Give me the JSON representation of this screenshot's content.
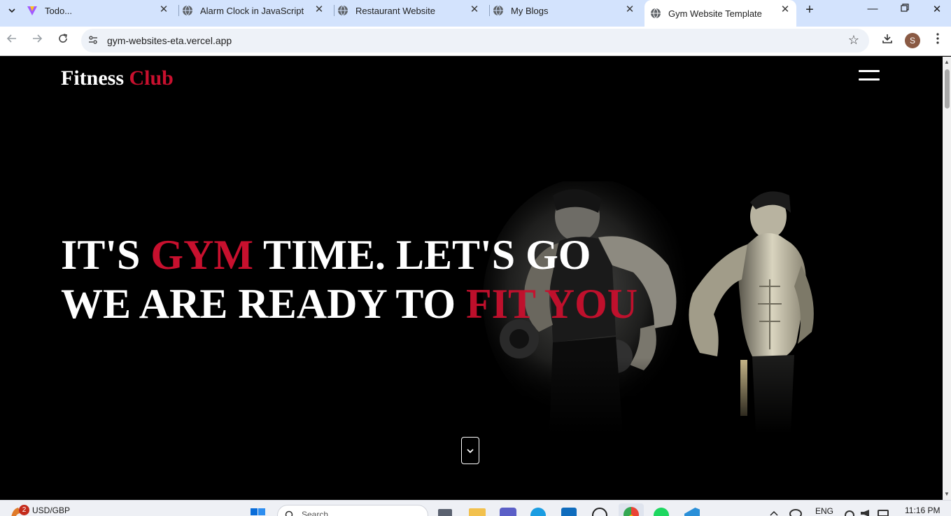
{
  "browser": {
    "tabs": [
      {
        "title": "Todo...",
        "icon": "vite-icon"
      },
      {
        "title": "Alarm Clock in JavaScript",
        "icon": "globe-icon"
      },
      {
        "title": "Restaurant Website",
        "icon": "globe-icon"
      },
      {
        "title": "My Blogs",
        "icon": "globe-icon"
      },
      {
        "title": "Gym Website Template",
        "icon": "globe-icon",
        "active": true
      }
    ],
    "url": "gym-websites-eta.vercel.app",
    "profile_initial": "S"
  },
  "site": {
    "brand_main": "Fitness",
    "brand_accent": "Club",
    "headline": {
      "line1_a": "IT'S ",
      "line1_red": "GYM",
      "line1_b": " TIME. LET'S GO",
      "line2_a": "WE ARE READY TO ",
      "line2_red": "FIT YOU"
    },
    "colors": {
      "accent": "#c8102e",
      "background": "#000000",
      "text": "#ffffff"
    }
  },
  "taskbar": {
    "weather_badge": "2",
    "ticker": "USD/GBP",
    "search_placeholder": "Search",
    "language": "ENG",
    "time": "11:16 PM"
  }
}
